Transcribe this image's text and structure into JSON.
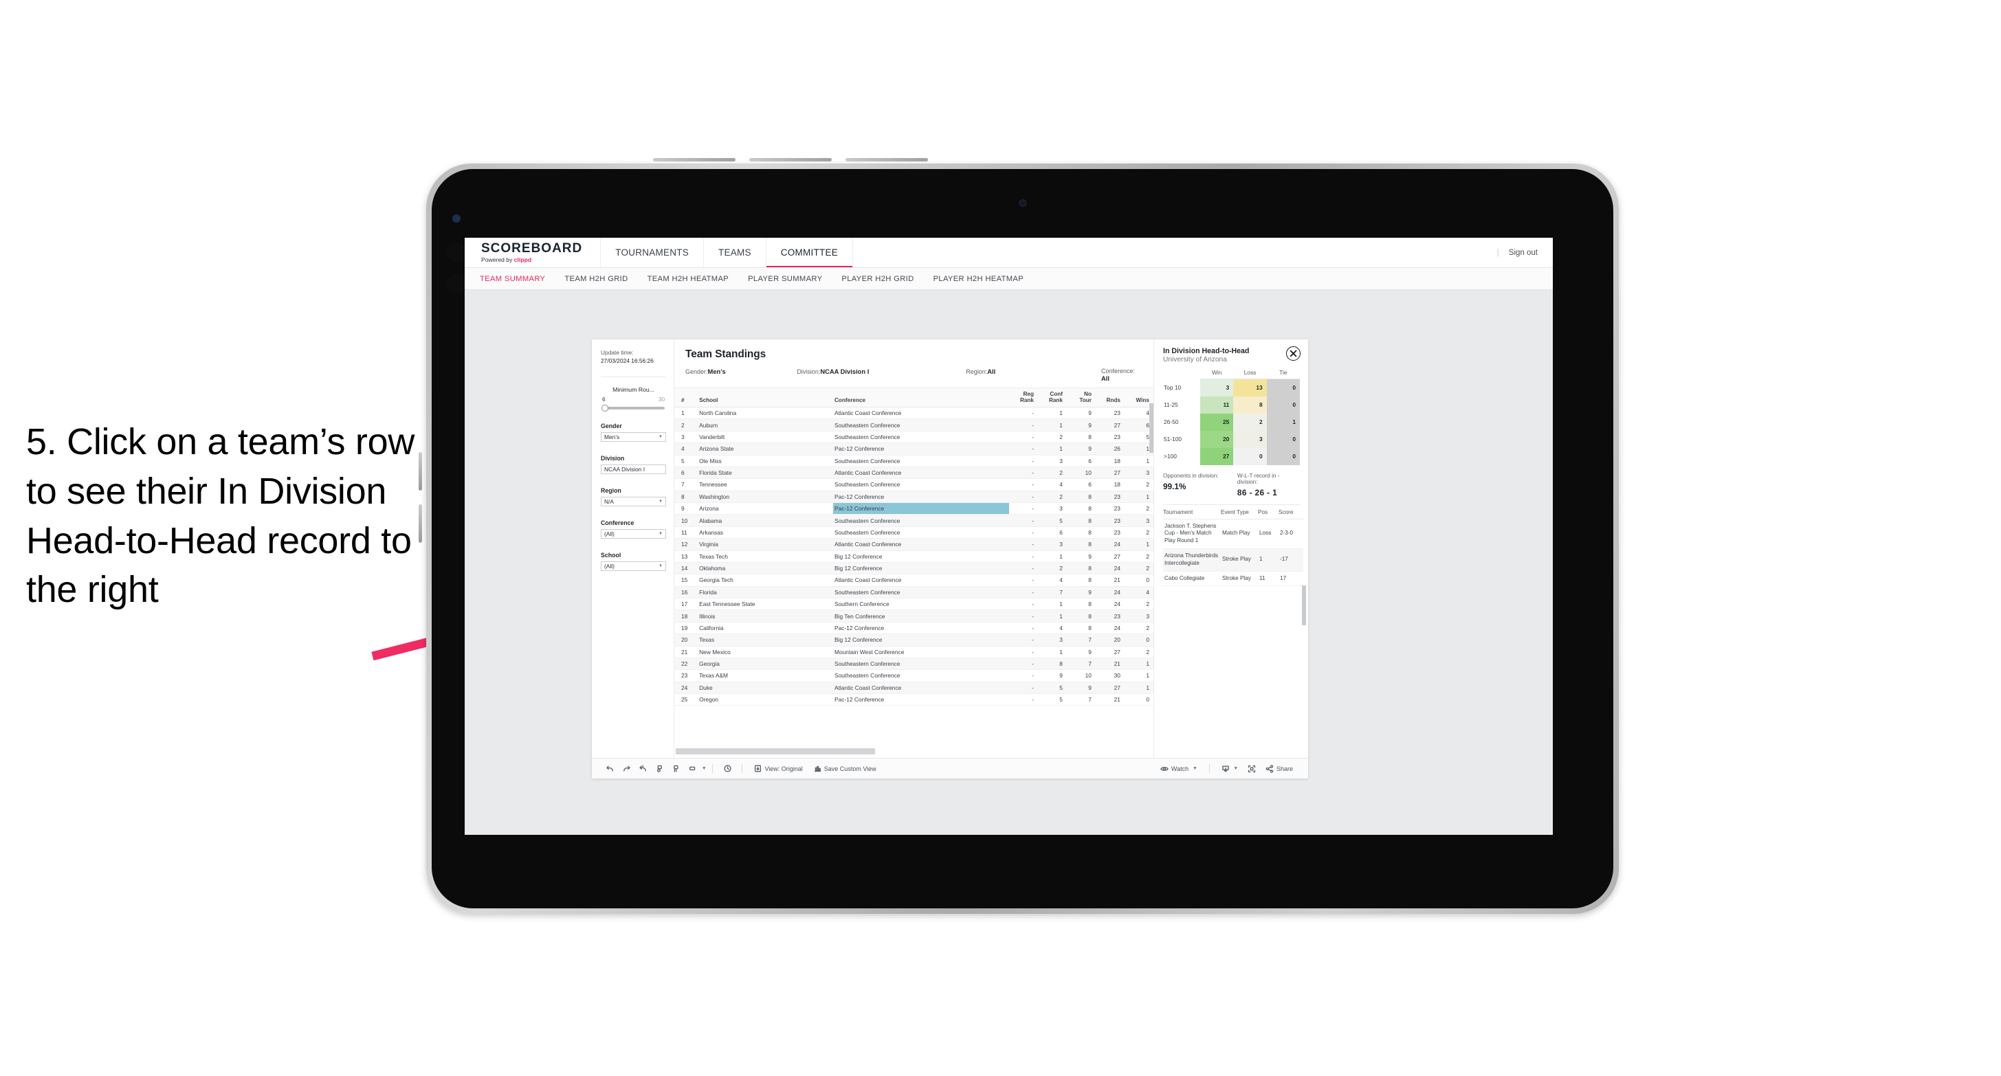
{
  "annotation": {
    "text": "5. Click on a team’s row to see their In Division Head-to-Head record to the right",
    "arrow_color": "#ef2d63"
  },
  "header": {
    "brand_title": "SCOREBOARD",
    "brand_sub_prefix": "Powered by ",
    "brand_sub_name": "clippd",
    "nav": [
      {
        "label": "TOURNAMENTS",
        "active": false
      },
      {
        "label": "TEAMS",
        "active": false
      },
      {
        "label": "COMMITTEE",
        "active": true
      }
    ],
    "divider": "|",
    "sign_out": "Sign out",
    "accent_color": "#e8275a"
  },
  "sub_nav": [
    {
      "label": "TEAM SUMMARY",
      "active": true
    },
    {
      "label": "TEAM H2H GRID",
      "active": false
    },
    {
      "label": "TEAM H2H HEATMAP",
      "active": false
    },
    {
      "label": "PLAYER SUMMARY",
      "active": false
    },
    {
      "label": "PLAYER H2H GRID",
      "active": false
    },
    {
      "label": "PLAYER H2H HEATMAP",
      "active": false
    }
  ],
  "filters": {
    "update_time_label": "Update time:",
    "update_time_value": "27/03/2024 16:56:26",
    "slider": {
      "title": "Minimum Rou...",
      "min": "6",
      "max": "30"
    },
    "groups": [
      {
        "label": "Gender",
        "value": "Men’s"
      },
      {
        "label": "Division",
        "value": "NCAA Division I"
      },
      {
        "label": "Region",
        "value": "N/A"
      },
      {
        "label": "Conference",
        "value": "(All)"
      },
      {
        "label": "School",
        "value": "(All)"
      }
    ]
  },
  "standings": {
    "title": "Team Standings",
    "meta": [
      {
        "label": "Gender: ",
        "value": "Men’s"
      },
      {
        "label": "Division: ",
        "value": "NCAA Division I"
      },
      {
        "label": "Region: ",
        "value": "All"
      },
      {
        "label": "Conference: ",
        "value": "All"
      }
    ],
    "columns": [
      "#",
      "School",
      "Conference",
      "Reg Rank",
      "Conf Rank",
      "No Tour",
      "Rnds",
      "Wins"
    ],
    "rows": [
      {
        "rank": "1",
        "school": "North Carolina",
        "conference": "Atlantic Coast Conference",
        "reg": "-",
        "conf": "1",
        "notour": "9",
        "rnds": "23",
        "wins": "4"
      },
      {
        "rank": "2",
        "school": "Auburn",
        "conference": "Southeastern Conference",
        "reg": "-",
        "conf": "1",
        "notour": "9",
        "rnds": "27",
        "wins": "6"
      },
      {
        "rank": "3",
        "school": "Vanderbilt",
        "conference": "Southeastern Conference",
        "reg": "-",
        "conf": "2",
        "notour": "8",
        "rnds": "23",
        "wins": "5"
      },
      {
        "rank": "4",
        "school": "Arizona State",
        "conference": "Pac-12 Conference",
        "reg": "-",
        "conf": "1",
        "notour": "9",
        "rnds": "26",
        "wins": "1"
      },
      {
        "rank": "5",
        "school": "Ole Miss",
        "conference": "Southeastern Conference",
        "reg": "-",
        "conf": "3",
        "notour": "6",
        "rnds": "18",
        "wins": "1"
      },
      {
        "rank": "6",
        "school": "Florida State",
        "conference": "Atlantic Coast Conference",
        "reg": "-",
        "conf": "2",
        "notour": "10",
        "rnds": "27",
        "wins": "3"
      },
      {
        "rank": "7",
        "school": "Tennessee",
        "conference": "Southeastern Conference",
        "reg": "-",
        "conf": "4",
        "notour": "6",
        "rnds": "18",
        "wins": "2"
      },
      {
        "rank": "8",
        "school": "Washington",
        "conference": "Pac-12 Conference",
        "reg": "-",
        "conf": "2",
        "notour": "8",
        "rnds": "23",
        "wins": "1"
      },
      {
        "rank": "9",
        "school": "Arizona",
        "conference": "Pac-12 Conference",
        "reg": "-",
        "conf": "3",
        "notour": "8",
        "rnds": "23",
        "wins": "2",
        "selected": true
      },
      {
        "rank": "10",
        "school": "Alabama",
        "conference": "Southeastern Conference",
        "reg": "-",
        "conf": "5",
        "notour": "8",
        "rnds": "23",
        "wins": "3"
      },
      {
        "rank": "11",
        "school": "Arkansas",
        "conference": "Southeastern Conference",
        "reg": "-",
        "conf": "6",
        "notour": "8",
        "rnds": "23",
        "wins": "2"
      },
      {
        "rank": "12",
        "school": "Virginia",
        "conference": "Atlantic Coast Conference",
        "reg": "-",
        "conf": "3",
        "notour": "8",
        "rnds": "24",
        "wins": "1"
      },
      {
        "rank": "13",
        "school": "Texas Tech",
        "conference": "Big 12 Conference",
        "reg": "-",
        "conf": "1",
        "notour": "9",
        "rnds": "27",
        "wins": "2"
      },
      {
        "rank": "14",
        "school": "Oklahoma",
        "conference": "Big 12 Conference",
        "reg": "-",
        "conf": "2",
        "notour": "8",
        "rnds": "24",
        "wins": "2"
      },
      {
        "rank": "15",
        "school": "Georgia Tech",
        "conference": "Atlantic Coast Conference",
        "reg": "-",
        "conf": "4",
        "notour": "8",
        "rnds": "21",
        "wins": "0"
      },
      {
        "rank": "16",
        "school": "Florida",
        "conference": "Southeastern Conference",
        "reg": "-",
        "conf": "7",
        "notour": "9",
        "rnds": "24",
        "wins": "4"
      },
      {
        "rank": "17",
        "school": "East Tennessee State",
        "conference": "Southern Conference",
        "reg": "-",
        "conf": "1",
        "notour": "8",
        "rnds": "24",
        "wins": "2"
      },
      {
        "rank": "18",
        "school": "Illinois",
        "conference": "Big Ten Conference",
        "reg": "-",
        "conf": "1",
        "notour": "8",
        "rnds": "23",
        "wins": "3"
      },
      {
        "rank": "19",
        "school": "California",
        "conference": "Pac-12 Conference",
        "reg": "-",
        "conf": "4",
        "notour": "8",
        "rnds": "24",
        "wins": "2"
      },
      {
        "rank": "20",
        "school": "Texas",
        "conference": "Big 12 Conference",
        "reg": "-",
        "conf": "3",
        "notour": "7",
        "rnds": "20",
        "wins": "0"
      },
      {
        "rank": "21",
        "school": "New Mexico",
        "conference": "Mountain West Conference",
        "reg": "-",
        "conf": "1",
        "notour": "9",
        "rnds": "27",
        "wins": "2"
      },
      {
        "rank": "22",
        "school": "Georgia",
        "conference": "Southeastern Conference",
        "reg": "-",
        "conf": "8",
        "notour": "7",
        "rnds": "21",
        "wins": "1"
      },
      {
        "rank": "23",
        "school": "Texas A&M",
        "conference": "Southeastern Conference",
        "reg": "-",
        "conf": "9",
        "notour": "10",
        "rnds": "30",
        "wins": "1"
      },
      {
        "rank": "24",
        "school": "Duke",
        "conference": "Atlantic Coast Conference",
        "reg": "-",
        "conf": "5",
        "notour": "9",
        "rnds": "27",
        "wins": "1"
      },
      {
        "rank": "25",
        "school": "Oregon",
        "conference": "Pac-12 Conference",
        "reg": "-",
        "conf": "5",
        "notour": "7",
        "rnds": "21",
        "wins": "0"
      }
    ]
  },
  "h2h": {
    "title": "In Division Head-to-Head",
    "subtitle": "University of Arizona",
    "close_icon": "close-icon",
    "columns": [
      "Win",
      "Loss",
      "Tie"
    ],
    "rows": [
      {
        "band": "Top 10",
        "win": "3",
        "loss": "13",
        "tie": "0",
        "win_color": "#e2eedf",
        "loss_color": "#f3e49a",
        "tie_color": "#cfcfcf"
      },
      {
        "band": "11-25",
        "win": "11",
        "loss": "8",
        "tie": "0",
        "win_color": "#c9e5bd",
        "loss_color": "#f7edca",
        "tie_color": "#cfcfcf"
      },
      {
        "band": "26-50",
        "win": "25",
        "loss": "2",
        "tie": "1",
        "win_color": "#8fd37a",
        "loss_color": "#f0f0ea",
        "tie_color": "#cfcfcf"
      },
      {
        "band": "51-100",
        "win": "20",
        "loss": "3",
        "tie": "0",
        "win_color": "#9cd885",
        "loss_color": "#efeee7",
        "tie_color": "#cfcfcf"
      },
      {
        "band": ">100",
        "win": "27",
        "loss": "0",
        "tie": "0",
        "win_color": "#8ed279",
        "loss_color": "#f1f1f1",
        "tie_color": "#cfcfcf"
      }
    ],
    "stats": [
      {
        "label": "Opponents in division:",
        "value": "99.1%"
      },
      {
        "label": "W-L-T record in -division:",
        "value": "86 - 26 - 1"
      }
    ],
    "tournaments": {
      "columns": [
        "Tournament",
        "Event Type",
        "Pos",
        "Score"
      ],
      "rows": [
        {
          "name": "Jackson T. Stephens Cup - Men’s Match Play Round 1",
          "type": "Match Play",
          "pos": "Loss",
          "score": "2-3-0"
        },
        {
          "name": "Arizona Thunderbirds Intercollegiate",
          "type": "Stroke Play",
          "pos": "1",
          "score": "-17"
        },
        {
          "name": "Cabo Collegiate",
          "type": "Stroke Play",
          "pos": "11",
          "score": "17"
        }
      ]
    }
  },
  "toolbar": {
    "icons": [
      "undo-icon",
      "redo-icon",
      "revert-icon",
      "pause-icon",
      "refresh-data-icon",
      "layout-icon"
    ],
    "clock_icon": "clock-icon",
    "view_label": "View: Original",
    "view_icon": "view-icon",
    "save_view_label": "Save Custom View",
    "save_view_icon": "save-view-icon",
    "watch_label": "Watch",
    "watch_icon": "eye-icon",
    "download_icon": "download-icon",
    "fullscreen_icon": "fullscreen-icon",
    "share_label": "Share",
    "share_icon": "share-icon"
  }
}
